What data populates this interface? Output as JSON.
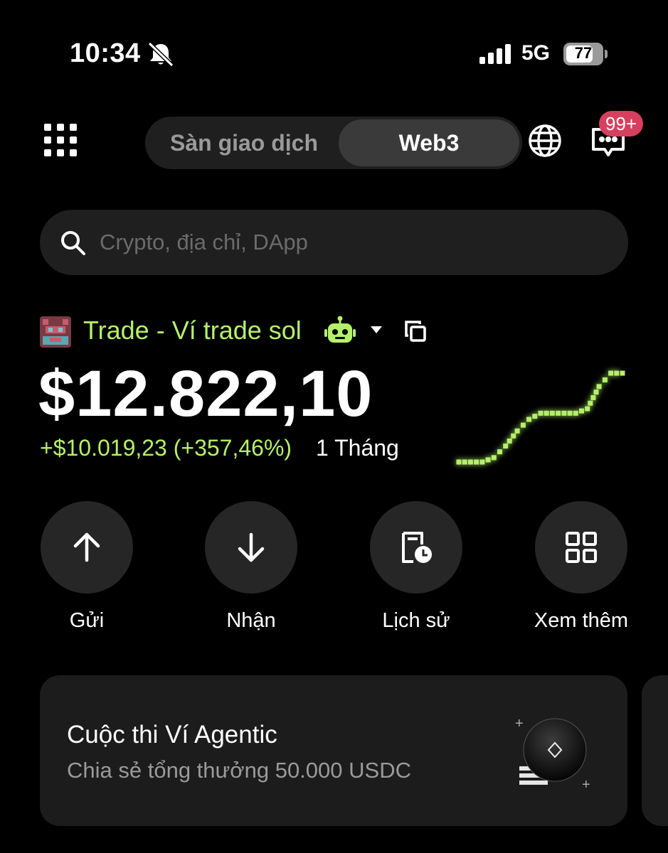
{
  "status_bar": {
    "time": "10:34",
    "network": "5G",
    "battery": "77",
    "battery_level": 0.77,
    "icons": [
      "bell-muted-icon",
      "signal-icon"
    ]
  },
  "nav": {
    "tabs": [
      {
        "label": "Sàn giao dịch",
        "active": false
      },
      {
        "label": "Web3",
        "active": true
      }
    ],
    "notification_badge": "99+",
    "icons": [
      "grid-menu-icon",
      "globe-icon",
      "chat-icon"
    ]
  },
  "search": {
    "placeholder": "Crypto, địa chỉ, DApp"
  },
  "wallet": {
    "name": "Trade - Ví trade sol",
    "balance": "$12.822,10",
    "pnl": "+$10.019,23 (+357,46%)",
    "period": "1 Tháng",
    "sparkline": [
      0,
      0,
      0,
      0.05,
      0.18,
      0.35,
      0.48,
      0.55,
      0.55,
      0.55,
      0.55,
      0.6,
      0.85,
      1.0,
      1.0
    ]
  },
  "actions": [
    {
      "label": "Gửi",
      "icon": "arrow-up-icon"
    },
    {
      "label": "Nhận",
      "icon": "arrow-down-icon"
    },
    {
      "label": "Lịch sử",
      "icon": "history-icon"
    },
    {
      "label": "Xem thêm",
      "icon": "more-grid-icon"
    }
  ],
  "promo": {
    "title": "Cuộc thi Ví Agentic",
    "subtitle": "Chia sẻ tổng thưởng 50.000 USDC"
  },
  "colors": {
    "accent_green": "#b5f06b",
    "badge_red": "#d6405e",
    "surface": "#1f1f1f"
  }
}
